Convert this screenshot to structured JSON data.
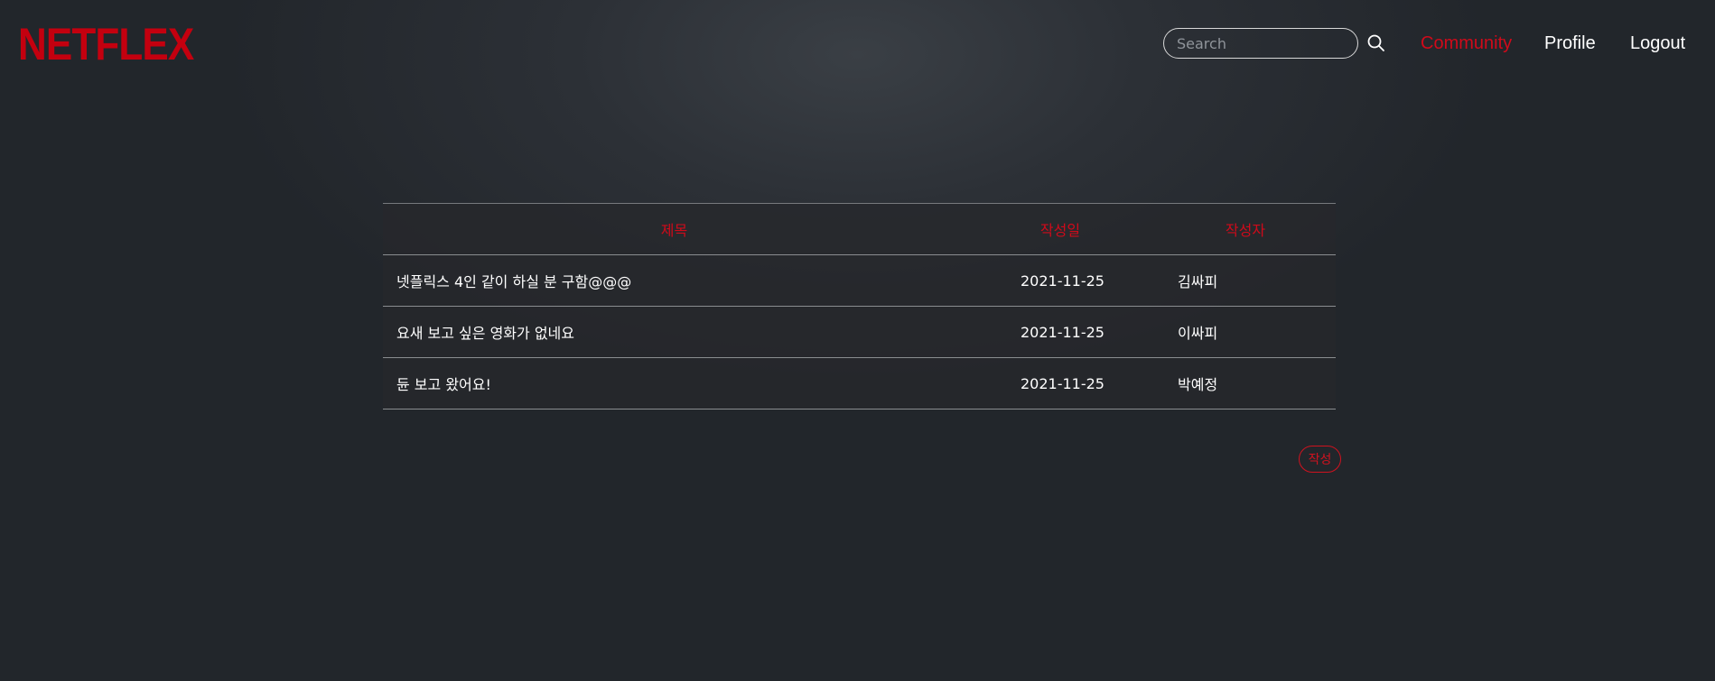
{
  "header": {
    "logo": "NETFLEX",
    "search": {
      "placeholder": "Search",
      "value": ""
    },
    "nav": [
      {
        "label": "Community",
        "active": true
      },
      {
        "label": "Profile",
        "active": false
      },
      {
        "label": "Logout",
        "active": false
      }
    ]
  },
  "board": {
    "columns": [
      "제목",
      "작성일",
      "작성자"
    ],
    "rows": [
      {
        "title": "넷플릭스 4인 같이 하실 분 구함@@@",
        "date": "2021-11-25",
        "author": "김싸피"
      },
      {
        "title": "요새 보고 싶은 영화가 없네요",
        "date": "2021-11-25",
        "author": "이싸피"
      },
      {
        "title": "듄 보고 왔어요!",
        "date": "2021-11-25",
        "author": "박예정"
      }
    ]
  },
  "write_button": "작성",
  "colors": {
    "accent": "#d00a1a",
    "logo": "#c4000f",
    "text": "#ffffff"
  }
}
